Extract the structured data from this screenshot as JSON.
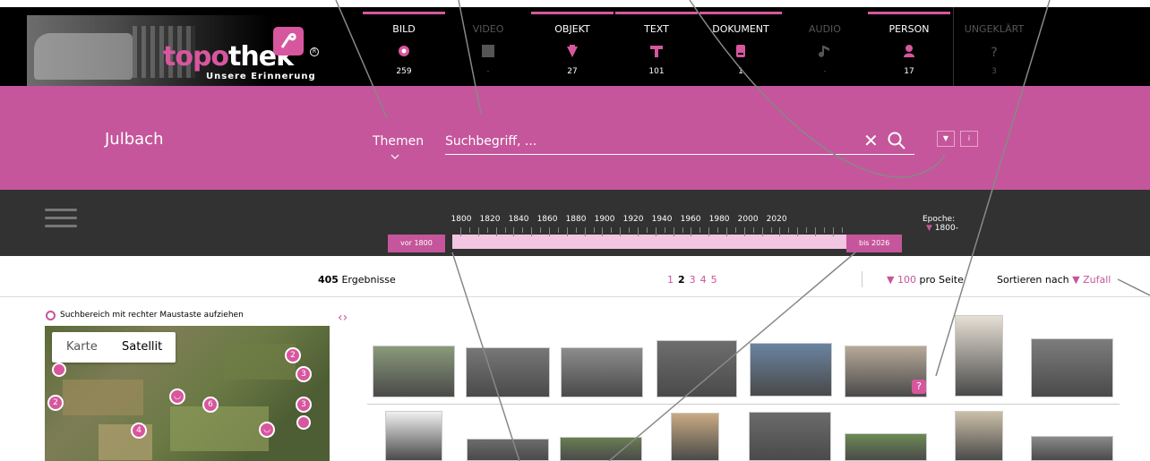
{
  "header": {
    "logo_text_a": "topo",
    "logo_text_b": "thek",
    "tagline": "Unsere Erinnerung",
    "categories": [
      {
        "label": "BILD",
        "count": "259",
        "icon": "image-icon",
        "active": true
      },
      {
        "label": "VIDEO",
        "count": "-",
        "icon": "video-icon",
        "active": false
      },
      {
        "label": "OBJEKT",
        "count": "27",
        "icon": "object-icon",
        "active": true
      },
      {
        "label": "TEXT",
        "count": "101",
        "icon": "text-icon",
        "active": true
      },
      {
        "label": "DOKUMENT",
        "count": "1",
        "icon": "document-icon",
        "active": true
      },
      {
        "label": "AUDIO",
        "count": "-",
        "icon": "audio-icon",
        "active": false
      },
      {
        "label": "PERSON",
        "count": "17",
        "icon": "person-icon",
        "active": true
      },
      {
        "label": "UNGEKLÄRT",
        "count": "3",
        "icon": "question-icon",
        "active": false
      }
    ]
  },
  "search": {
    "place": "Julbach",
    "themen_label": "Themen",
    "placeholder": "Suchbegriff, ...",
    "clear": "✕",
    "btn_filter": "▼",
    "btn_info": "i"
  },
  "timeline": {
    "years": [
      "1800",
      "1820",
      "1840",
      "1860",
      "1880",
      "1900",
      "1920",
      "1940",
      "1960",
      "1980",
      "2000",
      "2020"
    ],
    "left_handle": "vor 1800",
    "right_handle": "bis 2026",
    "epoche_label": "Epoche:",
    "epoche_value": "1800-"
  },
  "results": {
    "count": "405",
    "count_label": "Ergebnisse",
    "pages": [
      "1",
      "2",
      "3",
      "4",
      "5"
    ],
    "current_page": "2",
    "per_page_value": "100",
    "per_page_label": "pro Seite",
    "sort_label": "Sortieren nach",
    "sort_value": "Zufall"
  },
  "map": {
    "hint": "Suchbereich mit rechter Maustaste aufziehen",
    "karte": "Karte",
    "satellit": "Satellit",
    "pins": [
      "2",
      "3",
      "6",
      "3",
      "2",
      "4"
    ]
  },
  "colors": {
    "accent": "#c5569b",
    "dark": "#323232",
    "nav": "#000000"
  }
}
